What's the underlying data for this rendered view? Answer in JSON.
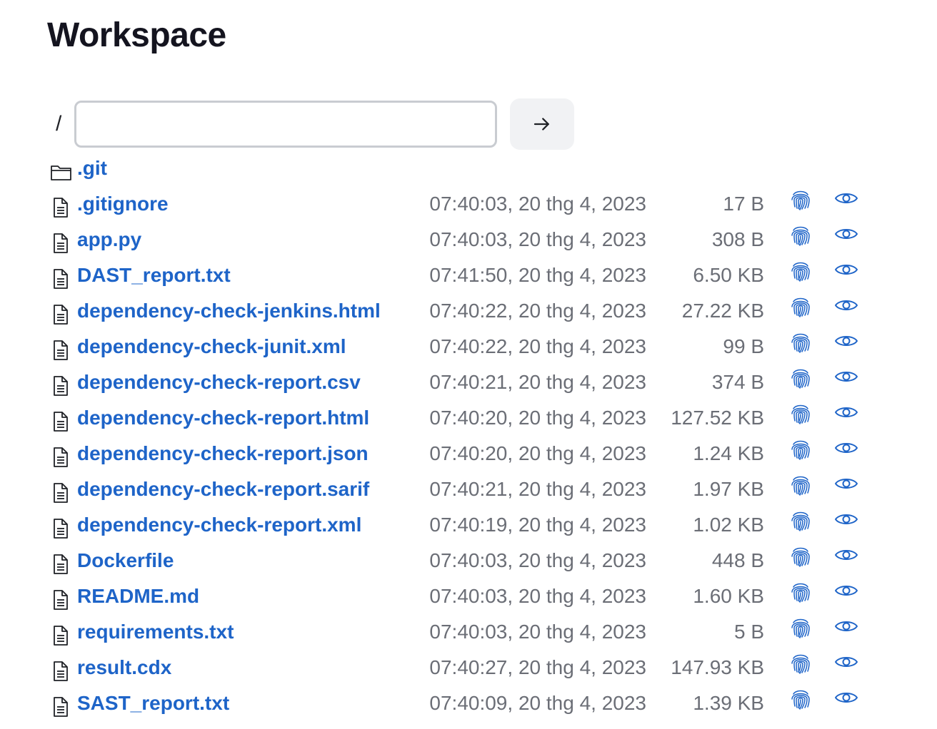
{
  "page": {
    "title": "Workspace"
  },
  "path_bar": {
    "root": "/",
    "value": "",
    "placeholder": "",
    "go_icon": "arrow-right-icon"
  },
  "colors": {
    "link": "#1e64c8",
    "muted": "#6b6e76",
    "input_border": "#c9ccd1",
    "button_bg": "#f1f2f4"
  },
  "entries": [
    {
      "type": "folder",
      "name": ".git",
      "mtime": "",
      "size": ""
    },
    {
      "type": "file",
      "name": ".gitignore",
      "mtime": "07:40:03, 20 thg 4, 2023",
      "size": "17 B"
    },
    {
      "type": "file",
      "name": "app.py",
      "mtime": "07:40:03, 20 thg 4, 2023",
      "size": "308 B"
    },
    {
      "type": "file",
      "name": "DAST_report.txt",
      "mtime": "07:41:50, 20 thg 4, 2023",
      "size": "6.50 KB"
    },
    {
      "type": "file",
      "name": "dependency-check-jenkins.html",
      "mtime": "07:40:22, 20 thg 4, 2023",
      "size": "27.22 KB"
    },
    {
      "type": "file",
      "name": "dependency-check-junit.xml",
      "mtime": "07:40:22, 20 thg 4, 2023",
      "size": "99 B"
    },
    {
      "type": "file",
      "name": "dependency-check-report.csv",
      "mtime": "07:40:21, 20 thg 4, 2023",
      "size": "374 B"
    },
    {
      "type": "file",
      "name": "dependency-check-report.html",
      "mtime": "07:40:20, 20 thg 4, 2023",
      "size": "127.52 KB"
    },
    {
      "type": "file",
      "name": "dependency-check-report.json",
      "mtime": "07:40:20, 20 thg 4, 2023",
      "size": "1.24 KB"
    },
    {
      "type": "file",
      "name": "dependency-check-report.sarif",
      "mtime": "07:40:21, 20 thg 4, 2023",
      "size": "1.97 KB"
    },
    {
      "type": "file",
      "name": "dependency-check-report.xml",
      "mtime": "07:40:19, 20 thg 4, 2023",
      "size": "1.02 KB"
    },
    {
      "type": "file",
      "name": "Dockerfile",
      "mtime": "07:40:03, 20 thg 4, 2023",
      "size": "448 B"
    },
    {
      "type": "file",
      "name": "README.md",
      "mtime": "07:40:03, 20 thg 4, 2023",
      "size": "1.60 KB"
    },
    {
      "type": "file",
      "name": "requirements.txt",
      "mtime": "07:40:03, 20 thg 4, 2023",
      "size": "5 B"
    },
    {
      "type": "file",
      "name": "result.cdx",
      "mtime": "07:40:27, 20 thg 4, 2023",
      "size": "147.93 KB"
    },
    {
      "type": "file",
      "name": "SAST_report.txt",
      "mtime": "07:40:09, 20 thg 4, 2023",
      "size": "1.39 KB"
    }
  ],
  "icons": {
    "folder": "folder-icon",
    "file": "file-text-icon",
    "fingerprint": "fingerprint-icon",
    "view": "eye-icon"
  }
}
